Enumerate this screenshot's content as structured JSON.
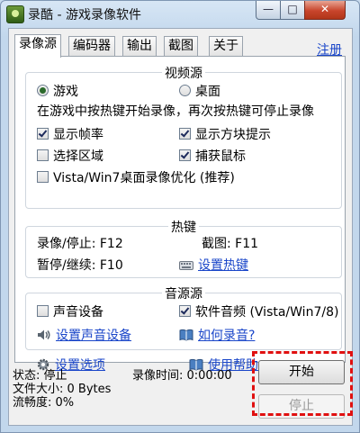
{
  "window": {
    "title": "录酷 - 游戏录像软件",
    "close_symbol": "✕",
    "min_symbol": "—",
    "max_symbol": "□"
  },
  "tabs": [
    {
      "label": "录像源",
      "active": true
    },
    {
      "label": "编码器",
      "active": false
    },
    {
      "label": "输出",
      "active": false
    },
    {
      "label": "截图",
      "active": false
    },
    {
      "label": "关于",
      "active": false
    }
  ],
  "register_link": "注册",
  "video_source": {
    "title": "视频源",
    "radio_game": "游戏",
    "radio_desktop": "桌面",
    "hint": "在游戏中按热键开始录像，再次按热键可停止录像",
    "show_fps": "显示帧率",
    "show_block_hint": "显示方块提示",
    "select_region": "选择区域",
    "capture_mouse": "捕获鼠标",
    "vista_opt": "Vista/Win7桌面录像优化 (推荐)"
  },
  "hotkeys": {
    "title": "热键",
    "record_stop": "录像/停止: F12",
    "screenshot": "截图: F11",
    "pause_resume": "暂停/继续: F10",
    "set_hotkey_link": "设置热键"
  },
  "audio_source": {
    "title": "音源源",
    "sound_device": "声音设备",
    "software_audio": "软件音频 (Vista/Win7/8)",
    "set_sound_device_link": "设置声音设备",
    "how_to_record_link": "如何录音?"
  },
  "bottom_links": {
    "settings": "设置选项",
    "help": "使用帮助"
  },
  "status": {
    "state": "状态: 停止",
    "record_time": "录像时间: 0:00:00",
    "file_size": "文件大小: 0 Bytes",
    "fluency": "流畅度: 0%"
  },
  "buttons": {
    "start": "开始",
    "stop": "停止"
  }
}
